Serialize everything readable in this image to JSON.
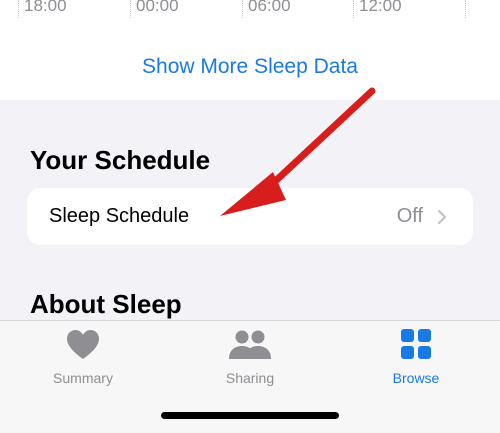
{
  "chart": {
    "axis_labels": [
      "18:00",
      "00:00",
      "06:00",
      "12:00"
    ]
  },
  "show_more_link": "Show More Sleep Data",
  "schedule_section": {
    "title": "Your Schedule",
    "row_label": "Sleep Schedule",
    "row_value": "Off"
  },
  "about_section": {
    "title": "About Sleep"
  },
  "tab_bar": {
    "tabs": [
      {
        "label": "Summary",
        "icon": "heart-icon",
        "active": false
      },
      {
        "label": "Sharing",
        "icon": "people-icon",
        "active": false
      },
      {
        "label": "Browse",
        "icon": "grid-icon",
        "active": true
      }
    ]
  },
  "colors": {
    "accent": "#1a7ae4",
    "inactive": "#8e8e93",
    "annotation_arrow": "#d81d1d",
    "background": "#f2f2f7"
  }
}
